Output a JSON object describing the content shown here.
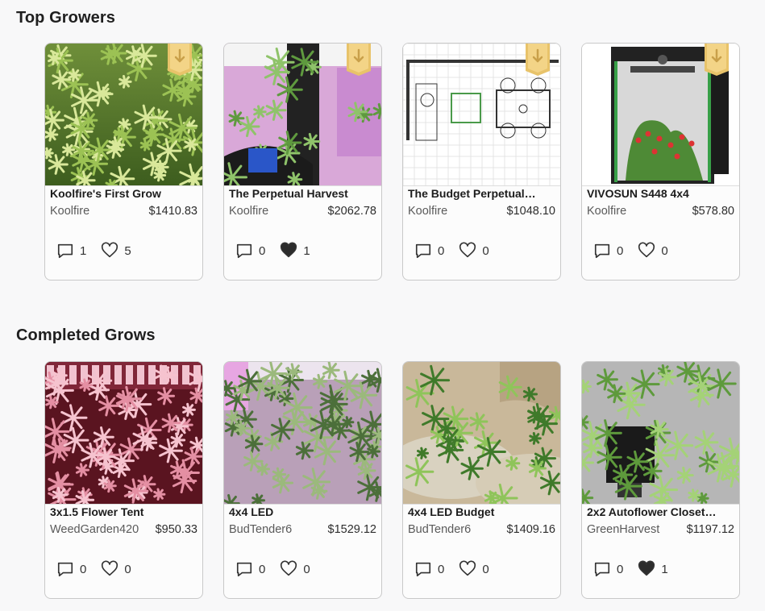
{
  "sections": [
    {
      "title": "Top Growers",
      "cards": [
        {
          "name": "Koolfire's First Grow",
          "author": "Koolfire",
          "price": "$1410.83",
          "comments": "1",
          "likes": "5",
          "liked": false,
          "badge": true,
          "thumb": "canopy-green"
        },
        {
          "name": "The Perpetual Harvest",
          "author": "Koolfire",
          "price": "$2062.78",
          "comments": "0",
          "likes": "1",
          "liked": true,
          "badge": true,
          "thumb": "tent-purple"
        },
        {
          "name": "The Budget Perpetual…",
          "author": "Koolfire",
          "price": "$1048.10",
          "comments": "0",
          "likes": "0",
          "liked": false,
          "badge": true,
          "thumb": "floorplan"
        },
        {
          "name": "VIVOSUN S448 4x4",
          "author": "Koolfire",
          "price": "$578.80",
          "comments": "0",
          "likes": "0",
          "liked": false,
          "badge": true,
          "thumb": "tent-product"
        }
      ]
    },
    {
      "title": "Completed Grows",
      "cards": [
        {
          "name": "3x1.5 Flower Tent",
          "author": "WeedGarden420",
          "price": "$950.33",
          "comments": "0",
          "likes": "0",
          "liked": false,
          "badge": false,
          "thumb": "canopy-red"
        },
        {
          "name": "4x4 LED",
          "author": "BudTender6",
          "price": "$1529.12",
          "comments": "0",
          "likes": "0",
          "liked": false,
          "badge": false,
          "thumb": "tent-pink"
        },
        {
          "name": "4x4 LED Budget",
          "author": "BudTender6",
          "price": "$1409.16",
          "comments": "0",
          "likes": "0",
          "liked": false,
          "badge": false,
          "thumb": "fabric-pots"
        },
        {
          "name": "2x2 Autoflower Closet…",
          "author": "GreenHarvest",
          "price": "$1197.12",
          "comments": "0",
          "likes": "1",
          "liked": true,
          "badge": false,
          "thumb": "closet-plants"
        }
      ]
    }
  ],
  "icons": {
    "comment": "comment-bubble-icon",
    "like": "heart-icon",
    "badge": "gold-ribbon-badge-icon"
  },
  "colors": {
    "badge_gold": "#e8c36a",
    "heart_filled": "#2c2c2c",
    "card_border": "#c9c9c9"
  }
}
